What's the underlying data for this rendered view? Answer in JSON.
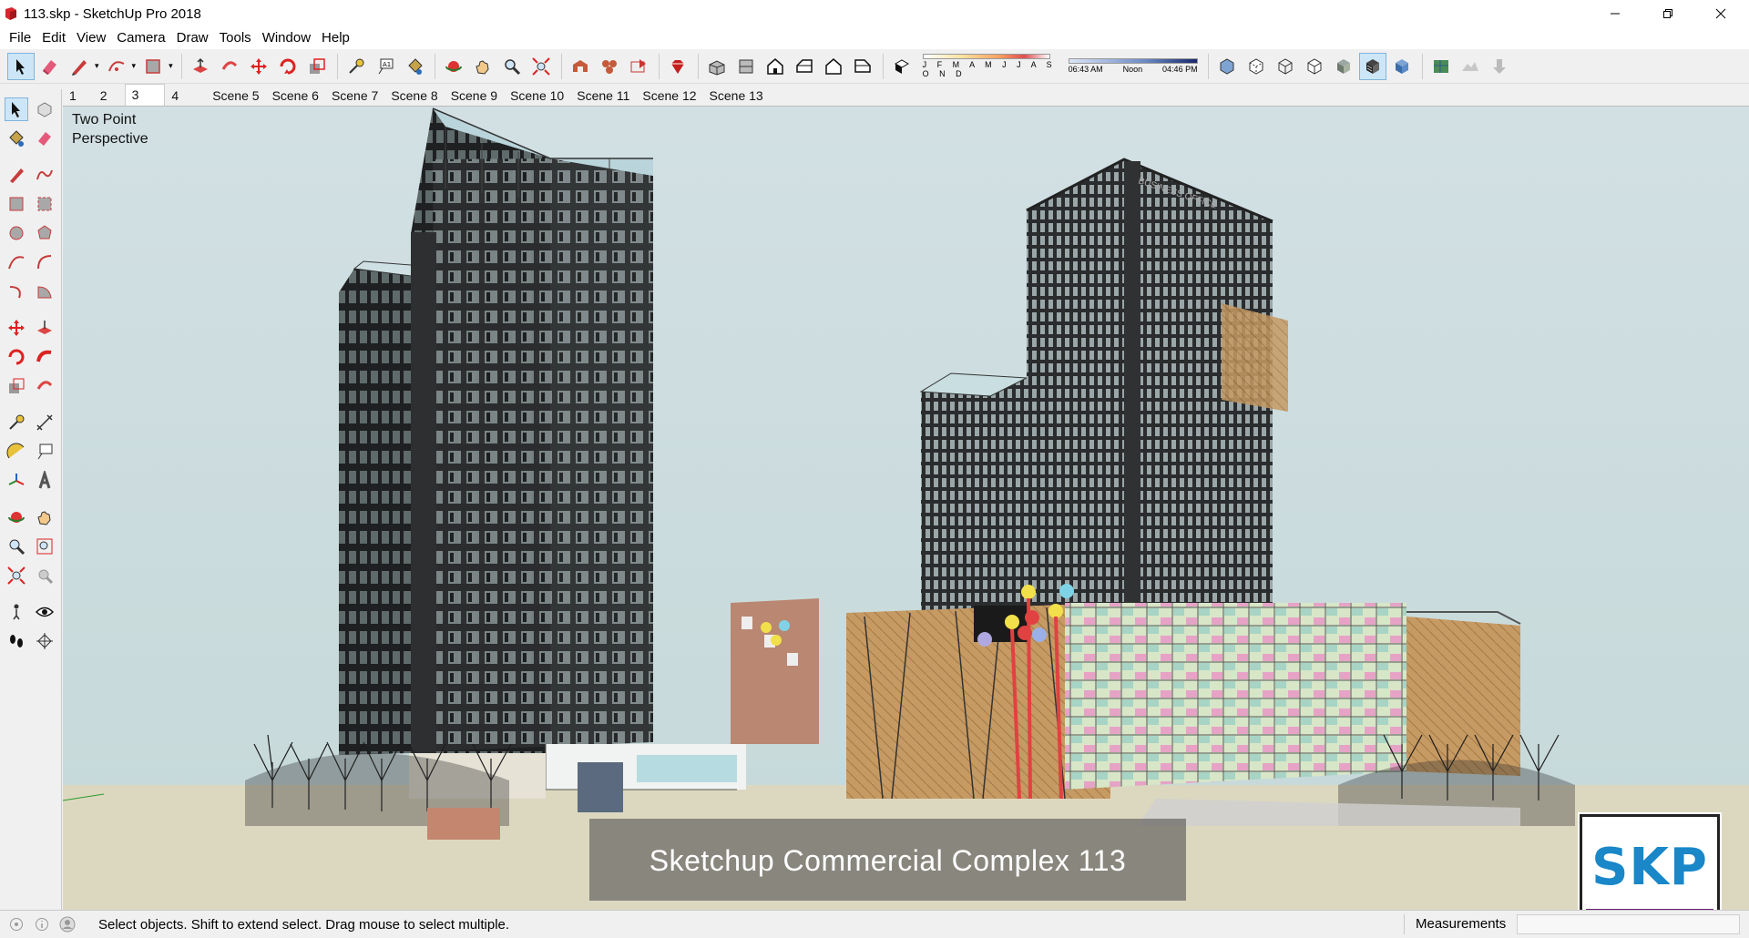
{
  "window": {
    "title": "113.skp - SketchUp Pro 2018",
    "controls": [
      "minimize-icon",
      "restore-icon",
      "close-icon"
    ]
  },
  "menubar": {
    "items": [
      "File",
      "Edit",
      "View",
      "Camera",
      "Draw",
      "Tools",
      "Window",
      "Help"
    ]
  },
  "toolbar": {
    "shadow_months": "J F M A M J J A S O N D",
    "time_start": "06:43 AM",
    "time_mid": "Noon",
    "time_end": "04:46 PM"
  },
  "scenes": {
    "tabs": [
      "1",
      "2",
      "3",
      "4",
      "Scene 5",
      "Scene 6",
      "Scene 7",
      "Scene 8",
      "Scene 9",
      "Scene 10",
      "Scene 11",
      "Scene 12",
      "Scene 13"
    ],
    "current": "3"
  },
  "viewport": {
    "camera_label_line1": "Two Point",
    "camera_label_line2": "Perspective",
    "caption": "Sketchup Commercial Complex 113",
    "logo": "SKP"
  },
  "statusbar": {
    "message": "Select objects. Shift to extend select. Drag mouse to select multiple.",
    "measurements_label": "Measurements",
    "measurements_value": ""
  },
  "colors": {
    "accent": "#1987c8",
    "sky": "#cadcdf",
    "tower": "#2b2d2e",
    "glass": "#a9c4c8"
  }
}
